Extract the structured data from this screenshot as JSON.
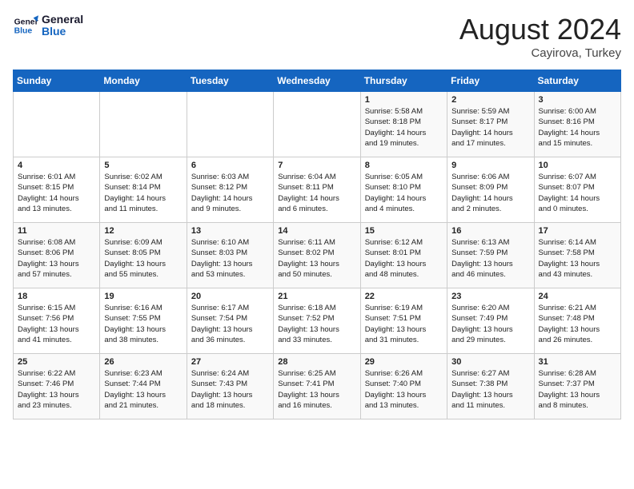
{
  "header": {
    "logo_line1": "General",
    "logo_line2": "Blue",
    "title": "August 2024",
    "subtitle": "Cayirova, Turkey"
  },
  "days_of_week": [
    "Sunday",
    "Monday",
    "Tuesday",
    "Wednesday",
    "Thursday",
    "Friday",
    "Saturday"
  ],
  "weeks": [
    [
      {
        "day": "",
        "info": ""
      },
      {
        "day": "",
        "info": ""
      },
      {
        "day": "",
        "info": ""
      },
      {
        "day": "",
        "info": ""
      },
      {
        "day": "1",
        "info": "Sunrise: 5:58 AM\nSunset: 8:18 PM\nDaylight: 14 hours\nand 19 minutes."
      },
      {
        "day": "2",
        "info": "Sunrise: 5:59 AM\nSunset: 8:17 PM\nDaylight: 14 hours\nand 17 minutes."
      },
      {
        "day": "3",
        "info": "Sunrise: 6:00 AM\nSunset: 8:16 PM\nDaylight: 14 hours\nand 15 minutes."
      }
    ],
    [
      {
        "day": "4",
        "info": "Sunrise: 6:01 AM\nSunset: 8:15 PM\nDaylight: 14 hours\nand 13 minutes."
      },
      {
        "day": "5",
        "info": "Sunrise: 6:02 AM\nSunset: 8:14 PM\nDaylight: 14 hours\nand 11 minutes."
      },
      {
        "day": "6",
        "info": "Sunrise: 6:03 AM\nSunset: 8:12 PM\nDaylight: 14 hours\nand 9 minutes."
      },
      {
        "day": "7",
        "info": "Sunrise: 6:04 AM\nSunset: 8:11 PM\nDaylight: 14 hours\nand 6 minutes."
      },
      {
        "day": "8",
        "info": "Sunrise: 6:05 AM\nSunset: 8:10 PM\nDaylight: 14 hours\nand 4 minutes."
      },
      {
        "day": "9",
        "info": "Sunrise: 6:06 AM\nSunset: 8:09 PM\nDaylight: 14 hours\nand 2 minutes."
      },
      {
        "day": "10",
        "info": "Sunrise: 6:07 AM\nSunset: 8:07 PM\nDaylight: 14 hours\nand 0 minutes."
      }
    ],
    [
      {
        "day": "11",
        "info": "Sunrise: 6:08 AM\nSunset: 8:06 PM\nDaylight: 13 hours\nand 57 minutes."
      },
      {
        "day": "12",
        "info": "Sunrise: 6:09 AM\nSunset: 8:05 PM\nDaylight: 13 hours\nand 55 minutes."
      },
      {
        "day": "13",
        "info": "Sunrise: 6:10 AM\nSunset: 8:03 PM\nDaylight: 13 hours\nand 53 minutes."
      },
      {
        "day": "14",
        "info": "Sunrise: 6:11 AM\nSunset: 8:02 PM\nDaylight: 13 hours\nand 50 minutes."
      },
      {
        "day": "15",
        "info": "Sunrise: 6:12 AM\nSunset: 8:01 PM\nDaylight: 13 hours\nand 48 minutes."
      },
      {
        "day": "16",
        "info": "Sunrise: 6:13 AM\nSunset: 7:59 PM\nDaylight: 13 hours\nand 46 minutes."
      },
      {
        "day": "17",
        "info": "Sunrise: 6:14 AM\nSunset: 7:58 PM\nDaylight: 13 hours\nand 43 minutes."
      }
    ],
    [
      {
        "day": "18",
        "info": "Sunrise: 6:15 AM\nSunset: 7:56 PM\nDaylight: 13 hours\nand 41 minutes."
      },
      {
        "day": "19",
        "info": "Sunrise: 6:16 AM\nSunset: 7:55 PM\nDaylight: 13 hours\nand 38 minutes."
      },
      {
        "day": "20",
        "info": "Sunrise: 6:17 AM\nSunset: 7:54 PM\nDaylight: 13 hours\nand 36 minutes."
      },
      {
        "day": "21",
        "info": "Sunrise: 6:18 AM\nSunset: 7:52 PM\nDaylight: 13 hours\nand 33 minutes."
      },
      {
        "day": "22",
        "info": "Sunrise: 6:19 AM\nSunset: 7:51 PM\nDaylight: 13 hours\nand 31 minutes."
      },
      {
        "day": "23",
        "info": "Sunrise: 6:20 AM\nSunset: 7:49 PM\nDaylight: 13 hours\nand 29 minutes."
      },
      {
        "day": "24",
        "info": "Sunrise: 6:21 AM\nSunset: 7:48 PM\nDaylight: 13 hours\nand 26 minutes."
      }
    ],
    [
      {
        "day": "25",
        "info": "Sunrise: 6:22 AM\nSunset: 7:46 PM\nDaylight: 13 hours\nand 23 minutes."
      },
      {
        "day": "26",
        "info": "Sunrise: 6:23 AM\nSunset: 7:44 PM\nDaylight: 13 hours\nand 21 minutes."
      },
      {
        "day": "27",
        "info": "Sunrise: 6:24 AM\nSunset: 7:43 PM\nDaylight: 13 hours\nand 18 minutes."
      },
      {
        "day": "28",
        "info": "Sunrise: 6:25 AM\nSunset: 7:41 PM\nDaylight: 13 hours\nand 16 minutes."
      },
      {
        "day": "29",
        "info": "Sunrise: 6:26 AM\nSunset: 7:40 PM\nDaylight: 13 hours\nand 13 minutes."
      },
      {
        "day": "30",
        "info": "Sunrise: 6:27 AM\nSunset: 7:38 PM\nDaylight: 13 hours\nand 11 minutes."
      },
      {
        "day": "31",
        "info": "Sunrise: 6:28 AM\nSunset: 7:37 PM\nDaylight: 13 hours\nand 8 minutes."
      }
    ]
  ]
}
